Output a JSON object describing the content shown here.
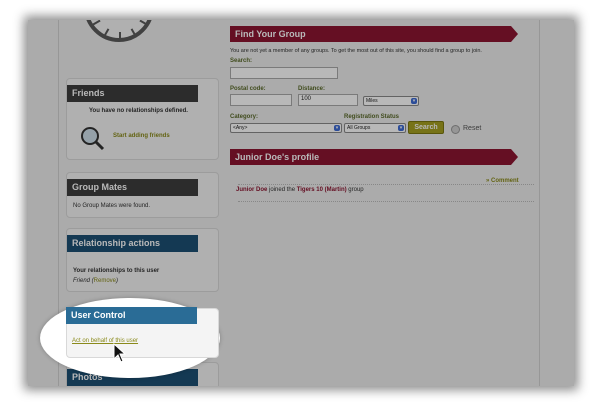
{
  "sidebar": {
    "friends": {
      "title": "Friends",
      "empty_text": "You have no relationships defined.",
      "add_link": "Start adding friends"
    },
    "group_mates": {
      "title": "Group Mates",
      "empty_text": "No Group Mates were found."
    },
    "relationship_actions": {
      "title": "Relationship actions",
      "heading": "Your relationships to this user",
      "friend_prefix": "Friend (",
      "remove": "Remove",
      "friend_suffix": ")"
    },
    "user_control": {
      "title": "User Control",
      "link": "Act on behalf of this user"
    },
    "photos": {
      "title": "Photos"
    }
  },
  "find_group": {
    "title": "Find Your Group",
    "notice": "You are not yet a member of any groups. To get the most out of this site, you should find a group to join.",
    "search_label": "Search:",
    "postal_label": "Postal code:",
    "distance_label": "Distance:",
    "distance_value": "100",
    "unit_value": "Miles",
    "category_label": "Category:",
    "category_value": "<Any>",
    "status_label": "Registration Status",
    "status_value": "All Groups",
    "search_button": "Search",
    "reset_label": "Reset"
  },
  "profile": {
    "title": "Junior Doe's profile",
    "comment_link": "» Comment",
    "activity_user": "Junior Doe",
    "activity_text": " joined the ",
    "activity_group": "Tigers 10 (Martin)",
    "activity_suffix": " group"
  },
  "colors": {
    "red_ribbon": "#8c1531",
    "blue_ribbon": "#1d4f73",
    "gray_ribbon": "#3e3e3e",
    "link_olive": "#8a8a1a",
    "search_button": "#a5a020"
  }
}
